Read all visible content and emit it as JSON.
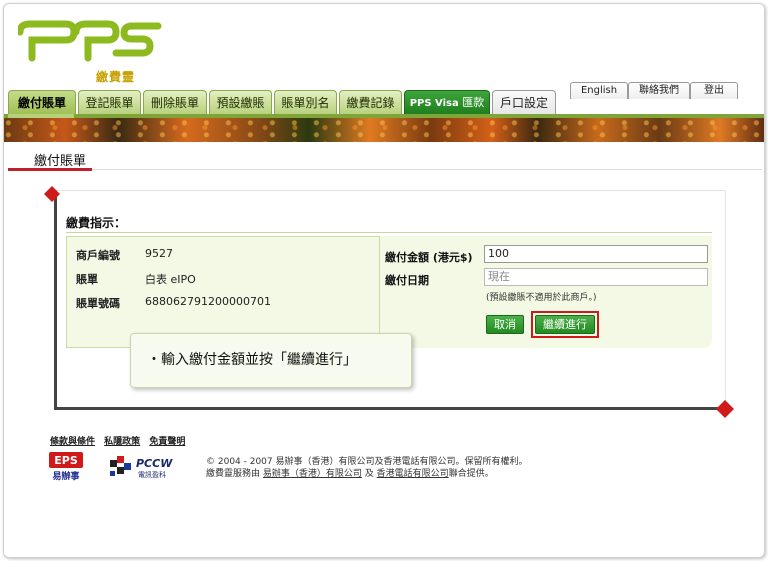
{
  "logo": {
    "text": "pps",
    "sub": "繳費靈"
  },
  "tabs": [
    {
      "label": "繳付賬單",
      "active": true
    },
    {
      "label": "登記賬單"
    },
    {
      "label": "刪除賬單"
    },
    {
      "label": "預設繳賬"
    },
    {
      "label": "賬單別名"
    },
    {
      "label": "繳費記錄"
    },
    {
      "label_a": "PPS Visa",
      "label_b": "匯款"
    },
    {
      "label": "戶口設定"
    }
  ],
  "util_links": {
    "english": "English",
    "contact": "聯絡我們",
    "logout": "登出"
  },
  "page_title": "繳付賬單",
  "instructions_title": "繳費指示：",
  "bill_info": {
    "merchant_label": "商戶編號",
    "merchant_value": "9527",
    "bill_label": "賬單",
    "bill_value": "白表 eIPO",
    "bill_no_label": "賬單號碼",
    "bill_no_value": "688062791200000701"
  },
  "form": {
    "amount_label": "繳付金額 (港元$)",
    "amount_value": "100",
    "date_label": "繳付日期",
    "date_value": "現在",
    "note": "(預設繳賬不適用於此商戶。)",
    "cancel_label": "取消",
    "continue_label": "繼續進行"
  },
  "tooltip": "・輸入繳付金額並按「繼續進行」",
  "footer": {
    "links": [
      "條款與條件",
      "私隱政策",
      "免責聲明"
    ],
    "eps_logo": "EPS 易辦事",
    "pccw_logo": "PCCW 電訊盈科",
    "copyright_line1": "© 2004 - 2007 易辦事（香港）有限公司及香港電話有限公司。保留所有權利。",
    "line2_prefix": "繳費靈服務由",
    "line2_link1": "易辦事（香港）有限公司",
    "line2_mid": "及",
    "line2_link2": "香港電話有限公司",
    "line2_suffix": "聯合提供。"
  },
  "colors": {
    "accent_green": "#7fa43a",
    "visa_green": "#228a20",
    "highlight_red": "#d01a1a"
  }
}
